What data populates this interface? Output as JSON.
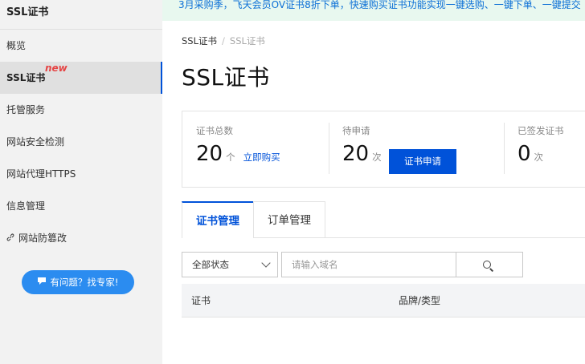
{
  "sidebar": {
    "title": "SSL证书",
    "items": [
      {
        "label": "概览"
      },
      {
        "label": "SSL证书",
        "badge": "new",
        "active": true
      },
      {
        "label": "托管服务"
      },
      {
        "label": "网站安全检测"
      },
      {
        "label": "网站代理HTTPS"
      },
      {
        "label": "信息管理"
      },
      {
        "label": "网站防篡改",
        "icon": "link-icon"
      }
    ],
    "help_button": "有问题？找专家!"
  },
  "banner": {
    "text": "3月采购季，飞天会员OV证书8折下单，快速购买证书功能实现一键选购、一键下单、一键提交"
  },
  "breadcrumb": {
    "root": "SSL证书",
    "separator": "/",
    "current": "SSL证书"
  },
  "page_title": "SSL证书",
  "stats": {
    "total": {
      "label": "证书总数",
      "value": "20",
      "unit": "个",
      "link": "立即购买"
    },
    "pending": {
      "label": "待申请",
      "value": "20",
      "unit": "次",
      "button": "证书申请"
    },
    "issued": {
      "label": "已签发证书",
      "value": "0",
      "unit": "次"
    }
  },
  "tabs": [
    {
      "label": "证书管理",
      "active": true
    },
    {
      "label": "订单管理",
      "active": false
    }
  ],
  "filters": {
    "status_select": "全部状态",
    "search_placeholder": "请输入域名"
  },
  "table": {
    "columns": [
      "证书",
      "品牌/类型"
    ]
  },
  "colors": {
    "accent": "#0052d9",
    "help_button": "#2b8cf0",
    "banner_bg": "#e8f8ef",
    "badge": "#e54545"
  }
}
